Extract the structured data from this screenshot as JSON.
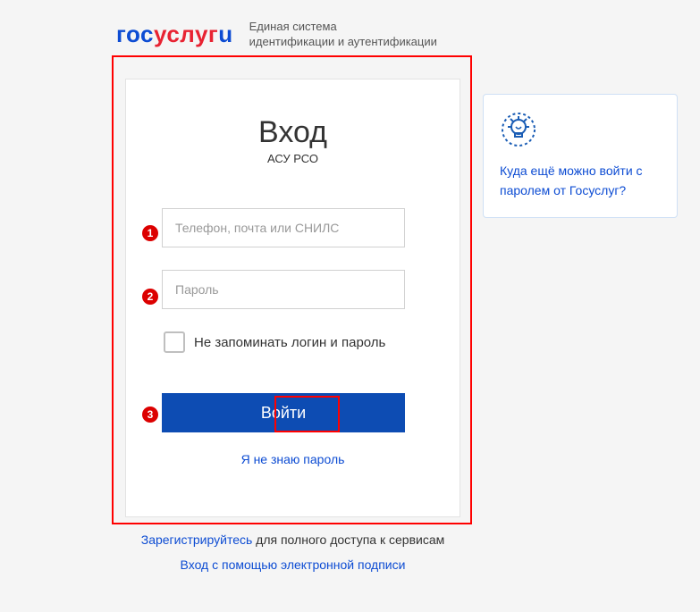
{
  "header": {
    "logo_gos": "гос",
    "logo_uslugi": "услуг",
    "logo_u": "u",
    "tagline_line1": "Единая система",
    "tagline_line2": "идентификации и аутентификации"
  },
  "login": {
    "title": "Вход",
    "subtitle": "АСУ РСО",
    "login_placeholder": "Телефон, почта или СНИЛС",
    "password_placeholder": "Пароль",
    "remember_label": "Не запоминать логин и пароль",
    "submit_label": "Войти",
    "forgot_label": "Я не знаю пароль"
  },
  "footer": {
    "register_link": "Зарегистрируйтесь",
    "register_rest": " для полного доступа к сервисам",
    "esign_link": "Вход с помощью электронной подписи"
  },
  "info": {
    "link_text": "Куда ещё можно войти с паролем от Госуслуг?"
  },
  "markers": {
    "m1": "1",
    "m2": "2",
    "m3": "3"
  }
}
